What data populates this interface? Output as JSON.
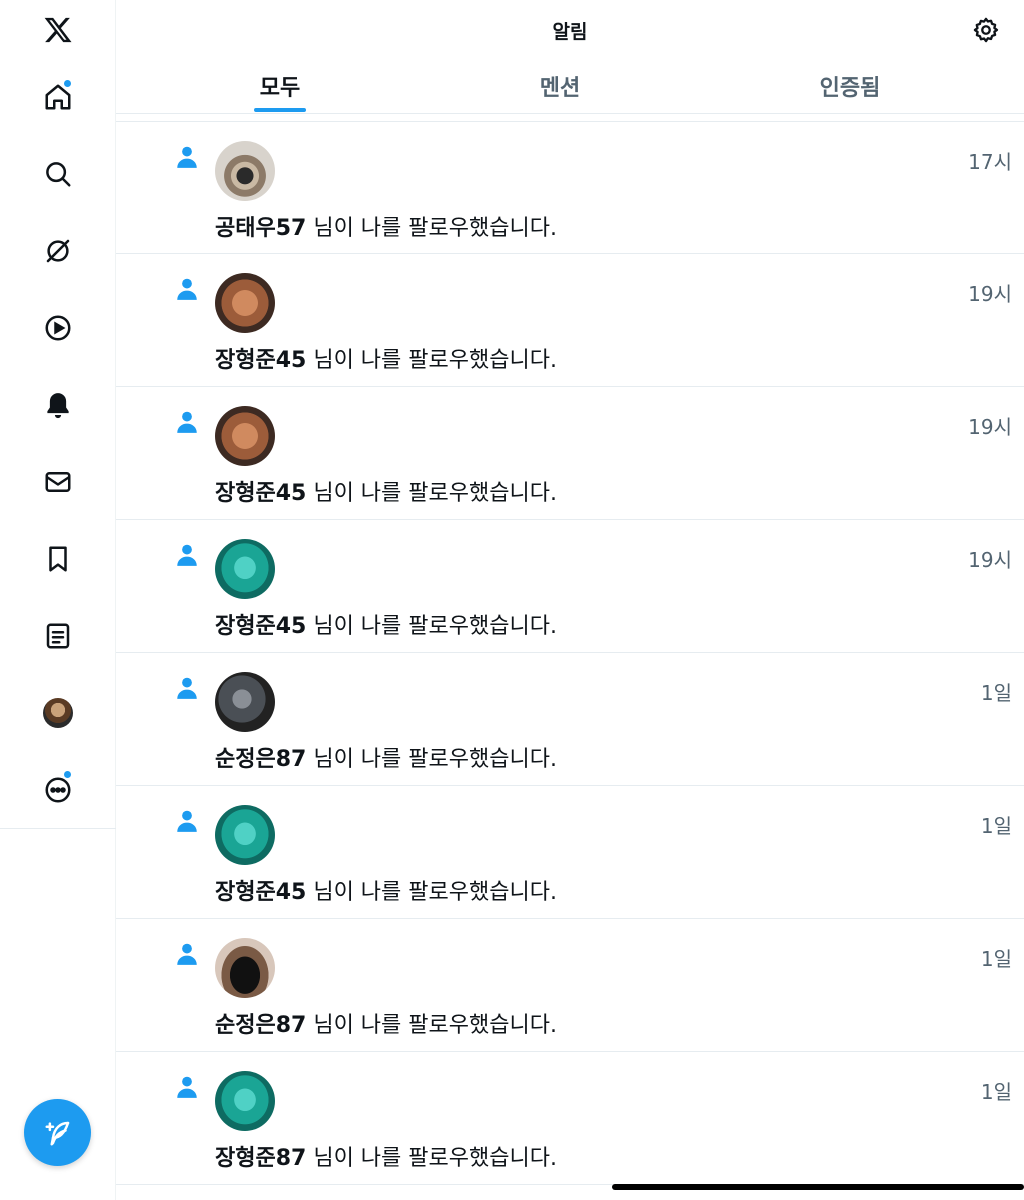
{
  "header": {
    "title": "알림"
  },
  "tabs": [
    {
      "label": "모두",
      "active": true
    },
    {
      "label": "멘션",
      "active": false
    },
    {
      "label": "인증됨",
      "active": false
    }
  ],
  "notifications": [
    {
      "username": "공태우57",
      "message": " 님이 나를 팔로우했습니다.",
      "time": "17시"
    },
    {
      "username": "장형준45",
      "message": " 님이 나를 팔로우했습니다.",
      "time": "19시"
    },
    {
      "username": "장형준45",
      "message": " 님이 나를 팔로우했습니다.",
      "time": "19시"
    },
    {
      "username": "장형준45",
      "message": " 님이 나를 팔로우했습니다.",
      "time": "19시"
    },
    {
      "username": "순정은87",
      "message": " 님이 나를 팔로우했습니다.",
      "time": "1일"
    },
    {
      "username": "장형준45",
      "message": " 님이 나를 팔로우했습니다.",
      "time": "1일"
    },
    {
      "username": "순정은87",
      "message": " 님이 나를 팔로우했습니다.",
      "time": "1일"
    },
    {
      "username": "장형준87",
      "message": " 님이 나를 팔로우했습니다.",
      "time": "1일"
    }
  ],
  "icons": {
    "logo": "x-logo-icon",
    "home": "home-icon",
    "search": "search-icon",
    "grok": "grok-icon",
    "video": "video-icon",
    "notifications": "bell-icon",
    "messages": "mail-icon",
    "bookmarks": "bookmark-icon",
    "lists": "list-icon",
    "more": "more-icon",
    "settings": "gear-icon",
    "compose": "compose-icon",
    "follow": "person-icon"
  },
  "colors": {
    "accent": "#1d9bf0",
    "text": "#0f1419",
    "secondary": "#536471",
    "border": "#e6ecf0"
  }
}
